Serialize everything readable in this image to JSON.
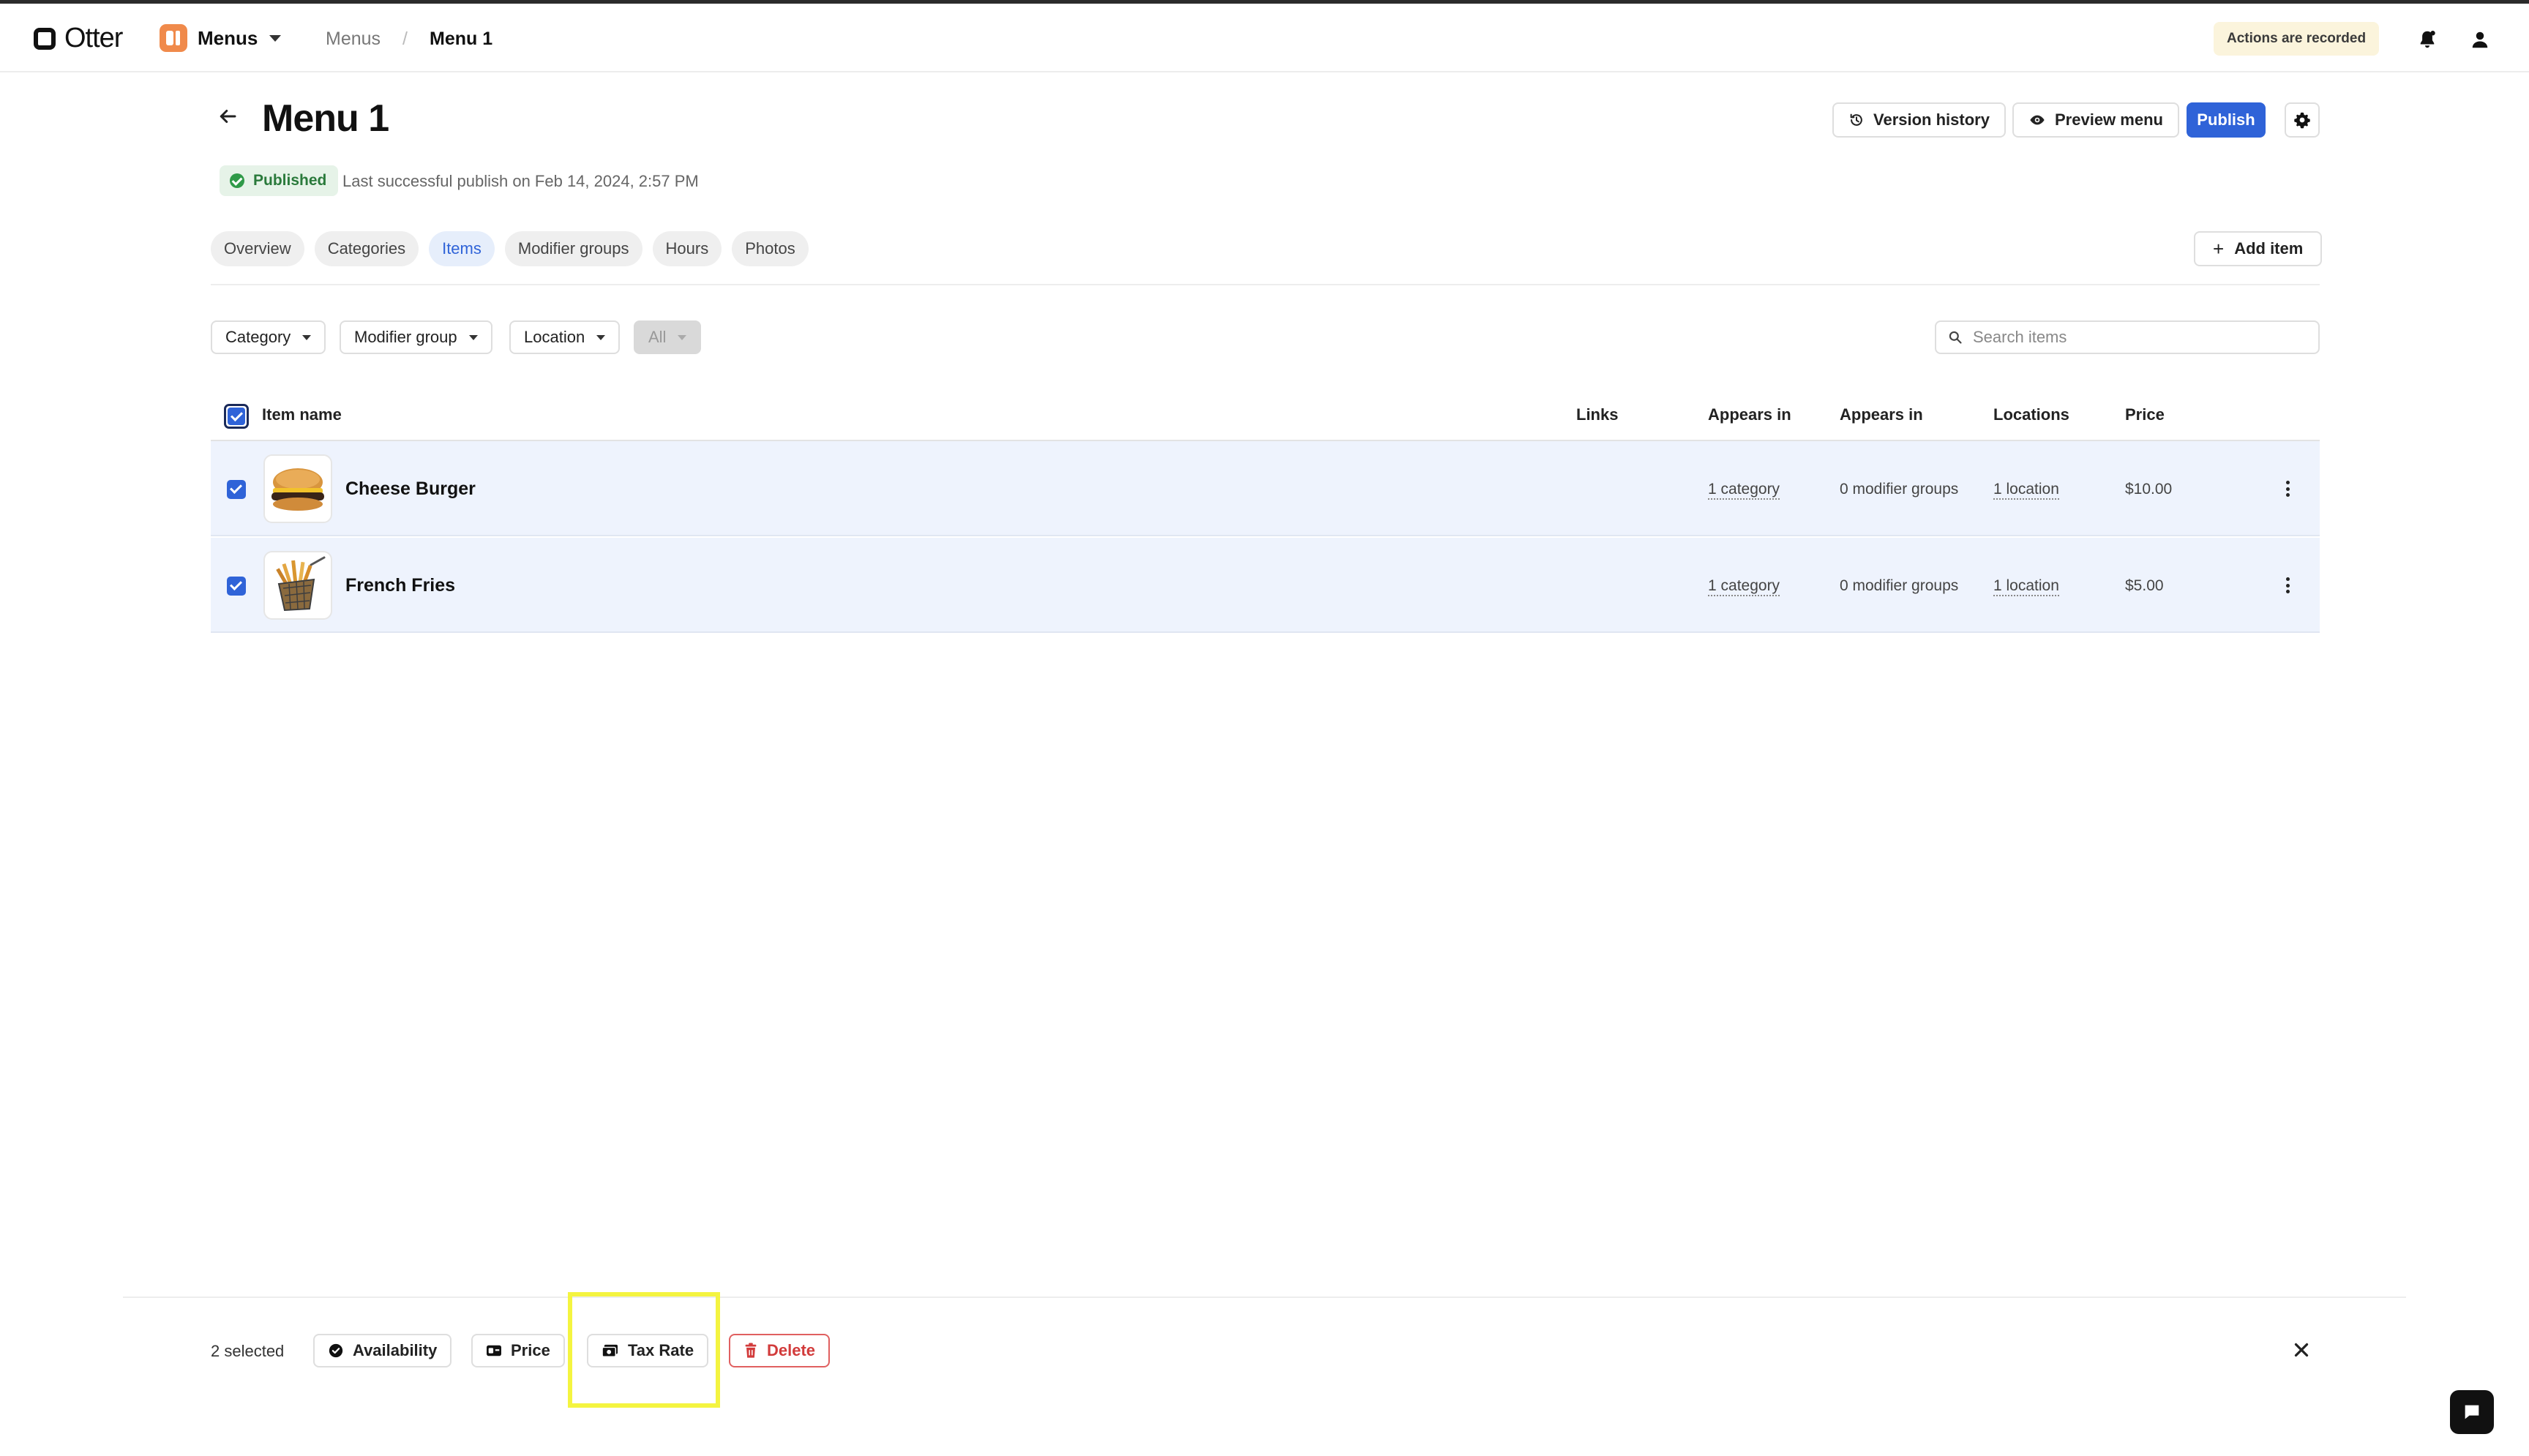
{
  "topbar": {
    "logo_text": "Otter",
    "app_name": "Menus",
    "breadcrumb": {
      "parent": "Menus",
      "separator": "/",
      "current": "Menu 1"
    },
    "recorded_badge": "Actions are recorded"
  },
  "header": {
    "title": "Menu 1",
    "version_history": "Version history",
    "preview_menu": "Preview menu",
    "publish": "Publish",
    "status": "Published",
    "publish_note": "Last successful publish on Feb 14, 2024, 2:57 PM"
  },
  "tabs": [
    "Overview",
    "Categories",
    "Items",
    "Modifier groups",
    "Hours",
    "Photos"
  ],
  "active_tab": "Items",
  "add_item": "Add item",
  "filters": {
    "category": "Category",
    "modifier_group": "Modifier group",
    "location": "Location",
    "all": "All",
    "search_placeholder": "Search items"
  },
  "table": {
    "columns": {
      "item_name": "Item name",
      "links": "Links",
      "appears_in_1": "Appears in",
      "appears_in_2": "Appears in",
      "locations": "Locations",
      "price": "Price"
    },
    "rows": [
      {
        "name": "Cheese Burger",
        "categories": "1 category",
        "modifiers": "0 modifier groups",
        "locations": "1 location",
        "price": "$10.00",
        "selected": true
      },
      {
        "name": "French Fries",
        "categories": "1 category",
        "modifiers": "0 modifier groups",
        "locations": "1 location",
        "price": "$5.00",
        "selected": true
      }
    ]
  },
  "action_bar": {
    "selected": "2 selected",
    "availability": "Availability",
    "price": "Price",
    "tax_rate": "Tax Rate",
    "delete": "Delete"
  },
  "colors": {
    "accent": "#2f63d8",
    "published": "#2a7a3b",
    "danger": "#d23b3b",
    "highlight": "#f4f440"
  }
}
